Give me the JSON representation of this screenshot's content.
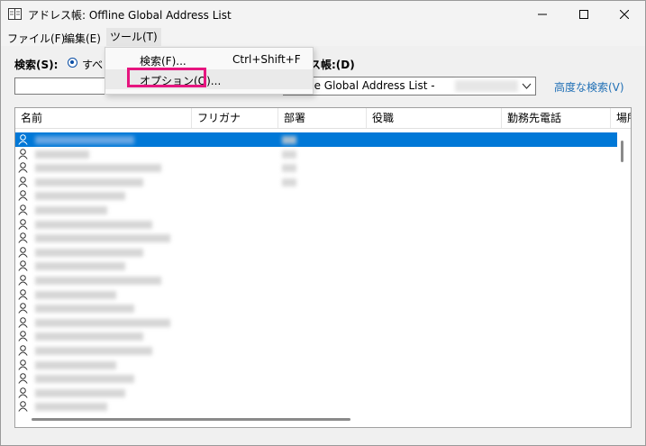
{
  "window": {
    "title": "アドレス帳: Offline Global Address List",
    "minimize_icon": "minimize-icon",
    "maximize_icon": "maximize-icon",
    "close_icon": "close-icon"
  },
  "menubar": {
    "items": [
      {
        "label": "ファイル(F)"
      },
      {
        "label": "編集(E)"
      },
      {
        "label": "ツール(T)"
      }
    ]
  },
  "tools_menu": {
    "items": [
      {
        "label": "検索(F)...",
        "shortcut": "Ctrl+Shift+F"
      },
      {
        "label": "オプション(O)...",
        "shortcut": ""
      }
    ],
    "highlight_color": "#e6157f"
  },
  "search": {
    "label": "検索(S):",
    "scope_partial": "すべ",
    "value": "",
    "address_book_label_partial": "ス帳:(D)",
    "address_book_value": "ne Global Address List -",
    "advanced_search": "高度な検索(V)"
  },
  "list": {
    "columns": [
      "名前",
      "フリガナ",
      "部署",
      "役職",
      "勤務先電話",
      "場所"
    ],
    "sort_indicator": "^",
    "person_icon": "person-icon",
    "row_count": 20,
    "selected_row": 0,
    "selection_color": "#0078d7"
  }
}
